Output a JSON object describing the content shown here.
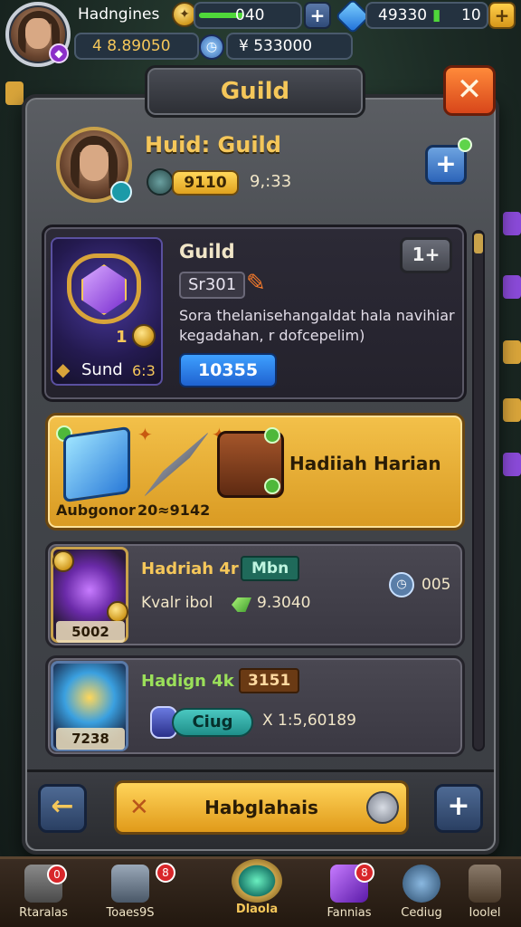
{
  "hud": {
    "player_name": "Hadngines",
    "energy_value": "040",
    "gold_value": "49330",
    "gems_value": "10",
    "currency_a": "4 8.89050",
    "currency_b": "¥ 533000"
  },
  "panel": {
    "title": "Guild",
    "close_symbol": "✕"
  },
  "guild_header": {
    "name": "Huid: Guild",
    "level_value": "9110",
    "points_value": "9,:33"
  },
  "info_card": {
    "title": "Guild",
    "tag": "Sr301",
    "level_button": "1+",
    "description_line1": "Sora thelanisehangaldat hala navihiar",
    "description_line2": "kegadahan, r dofcepelim)",
    "emblem_badge": "1",
    "emblem_label": "Sund",
    "emblem_count": "6:3",
    "blue_value": "10355"
  },
  "reward_card": {
    "title": "Hadiiah Harian",
    "label_left": "Aubgonor",
    "label_value": "20≈9142"
  },
  "rows": [
    {
      "title": "Hadriah 4r",
      "tag": "Mbn",
      "meta_label": "Kvalr ibol",
      "meta_value": "9.3040",
      "thumb_label": "5002",
      "time_value": "005"
    },
    {
      "title": "Hadign 4k",
      "tag": "3151",
      "pill_label": "Ciug",
      "meta_value": "X 1:5,60189",
      "thumb_label": "7238"
    }
  ],
  "action_bar": {
    "main_label": "Habglahais"
  },
  "nav": [
    {
      "label": "Rtaralas",
      "badge": "0"
    },
    {
      "label": "Toaes9S",
      "badge": "8"
    },
    {
      "label": "Dlaola",
      "badge": ""
    },
    {
      "label": "Fannias",
      "badge": "8"
    },
    {
      "label": "Cediug",
      "badge": ""
    },
    {
      "label": "Ioolel",
      "badge": ""
    }
  ],
  "colors": {
    "accent_gold": "#f5c75a",
    "panel_gray": "#44474c",
    "blue_button": "#2c64b8",
    "close_orange": "#d8461a"
  }
}
